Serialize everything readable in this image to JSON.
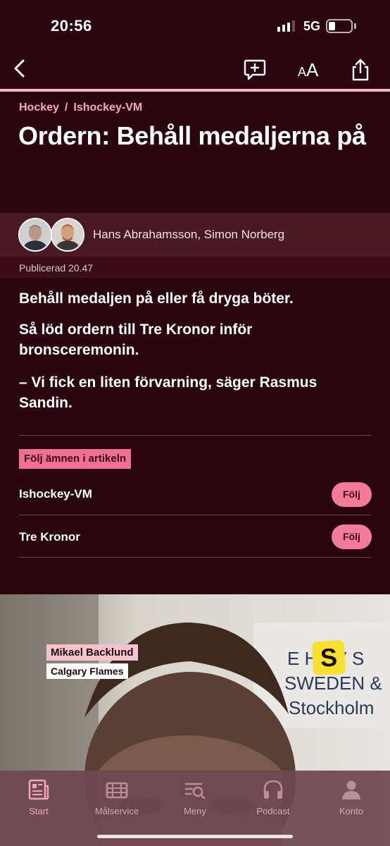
{
  "status_bar": {
    "time": "20:56",
    "network": "5G"
  },
  "toolbar": {
    "text_size_label_small": "A",
    "text_size_label_large": "A"
  },
  "breadcrumb": {
    "level1": "Hockey",
    "separator": "/",
    "level2": "Ishockey-VM"
  },
  "article": {
    "title": "Ordern: Behåll medaljerna på",
    "authors": "Hans Abrahamsson, Simon Norberg",
    "published": "Publicerad 20.47",
    "paragraphs": [
      "Behåll medaljen på eller få dryga böter.",
      "Så löd ordern till Tre Kronor inför bronsceremonin.",
      "– Vi fick en liten förvarning, säger Rasmus Sandin."
    ]
  },
  "follow_section": {
    "tag": "Följ ämnen i artikeln",
    "topics": [
      {
        "name": "Ishockey-VM",
        "button": "Följ"
      },
      {
        "name": "Tre Kronor",
        "button": "Följ"
      }
    ]
  },
  "video": {
    "lower_third_name": "Mikael Backlund",
    "lower_third_team": "Calgary Flames",
    "logo_letter": "S",
    "banner_text_1": "E H  EY S",
    "banner_text_2": "SWEDEN &",
    "banner_text_3": "Stockholm"
  },
  "tab_bar": {
    "tabs": [
      {
        "label": "Start",
        "icon": "newspaper-icon",
        "active": true
      },
      {
        "label": "Målservice",
        "icon": "scoreboard-icon",
        "active": false
      },
      {
        "label": "Meny",
        "icon": "menu-search-icon",
        "active": false
      },
      {
        "label": "Podcast",
        "icon": "headphones-icon",
        "active": false
      },
      {
        "label": "Konto",
        "icon": "user-icon",
        "active": false
      }
    ]
  },
  "colors": {
    "background": "#2a0610",
    "accent_pink": "#f06f93",
    "breadcrumb_pink": "#f3a9bb",
    "byline_bg": "#4a1a24"
  }
}
